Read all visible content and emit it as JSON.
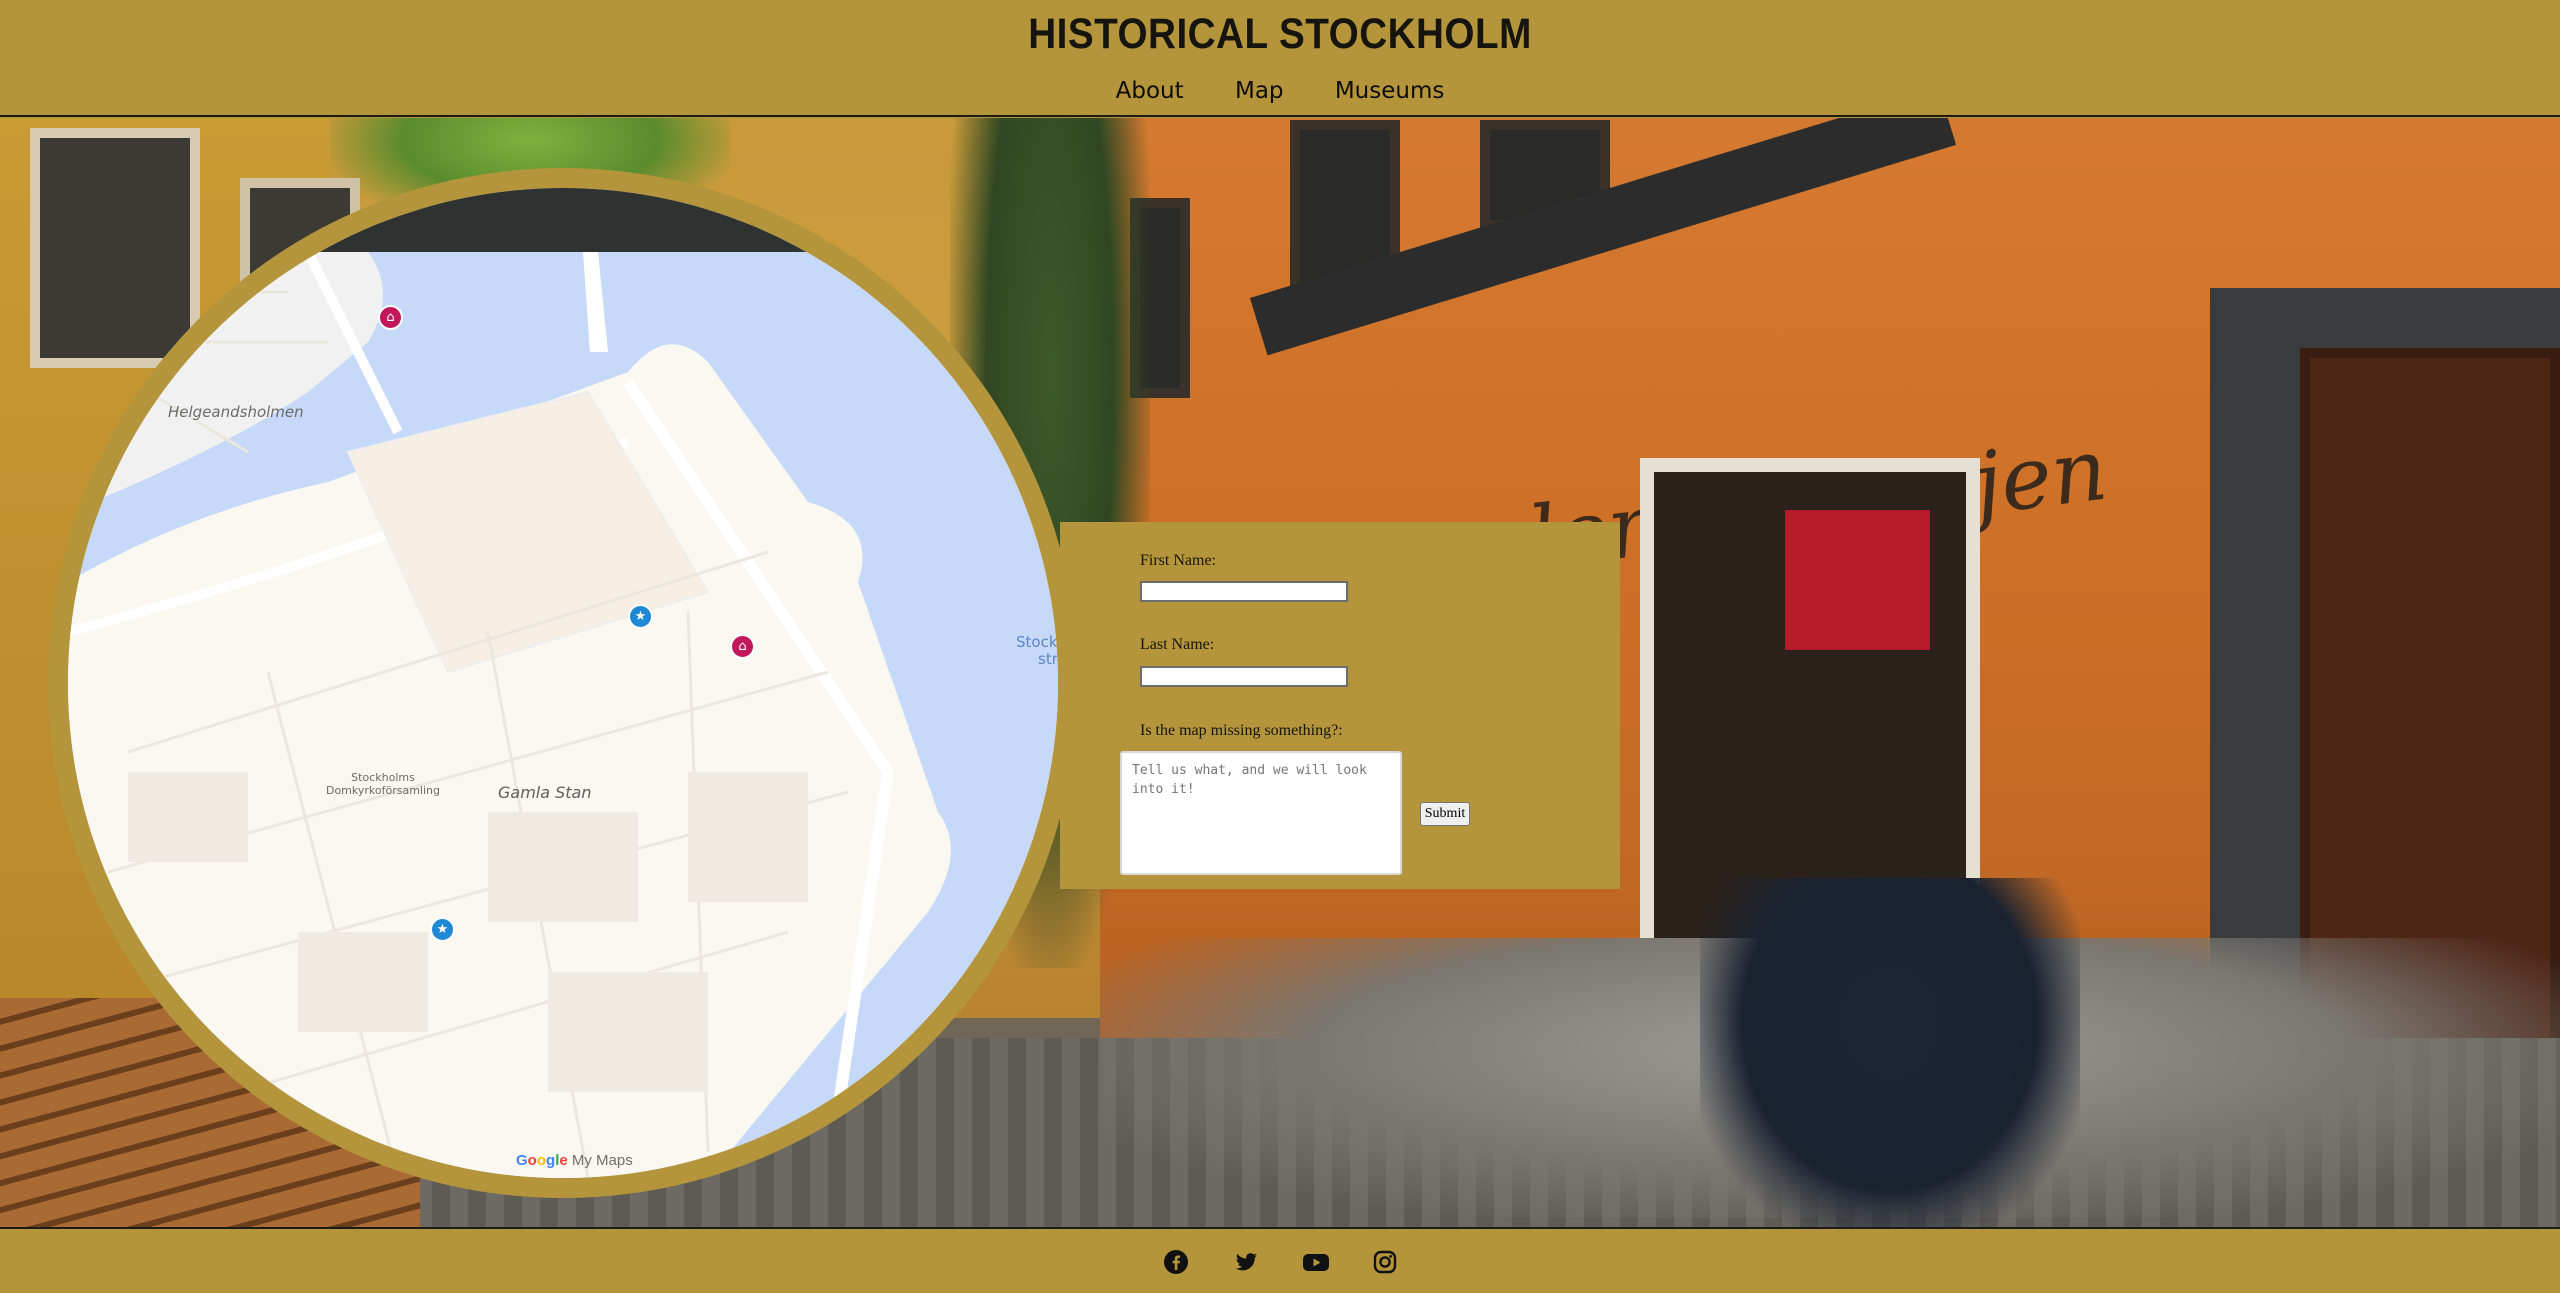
{
  "header": {
    "title": "HISTORICAL STOCKHOLM",
    "nav": [
      {
        "label": "About"
      },
      {
        "label": "Map"
      },
      {
        "label": "Museums"
      }
    ]
  },
  "hero": {
    "storefront_sign": "under Kastanjen"
  },
  "map": {
    "labels": {
      "helgeandsholmen": "Helgeandsholmen",
      "gamla_stan": "Gamla Stan",
      "domkyrko_line1": "Stockholms",
      "domkyrko_line2": "Domkyrkoförsamling",
      "strom_line1": "Stockh",
      "strom_line2": "strö"
    },
    "pins": [
      {
        "type": "museum",
        "icon": "museum-icon"
      },
      {
        "type": "star",
        "icon": "star-icon"
      },
      {
        "type": "museum",
        "icon": "museum-icon"
      },
      {
        "type": "star",
        "icon": "star-icon"
      }
    ],
    "credit_google": "Google",
    "credit_mymaps": "My Maps",
    "colors": {
      "water": "#c6d9f9",
      "land": "#f7f4ee",
      "museum_pin": "#c2185b",
      "star_pin": "#1e88d4"
    }
  },
  "form": {
    "first_name_label": "First Name:",
    "first_name_value": "",
    "last_name_label": "Last Name:",
    "last_name_value": "",
    "question_label": "Is the map missing something?:",
    "message_placeholder": "Tell us what, and we will look into it!",
    "submit_label": "Submit"
  },
  "footer": {
    "social": [
      {
        "name": "facebook-icon"
      },
      {
        "name": "twitter-icon"
      },
      {
        "name": "youtube-icon"
      },
      {
        "name": "instagram-icon"
      }
    ]
  },
  "colors": {
    "brand": "#b5953b",
    "text": "#15140f"
  }
}
